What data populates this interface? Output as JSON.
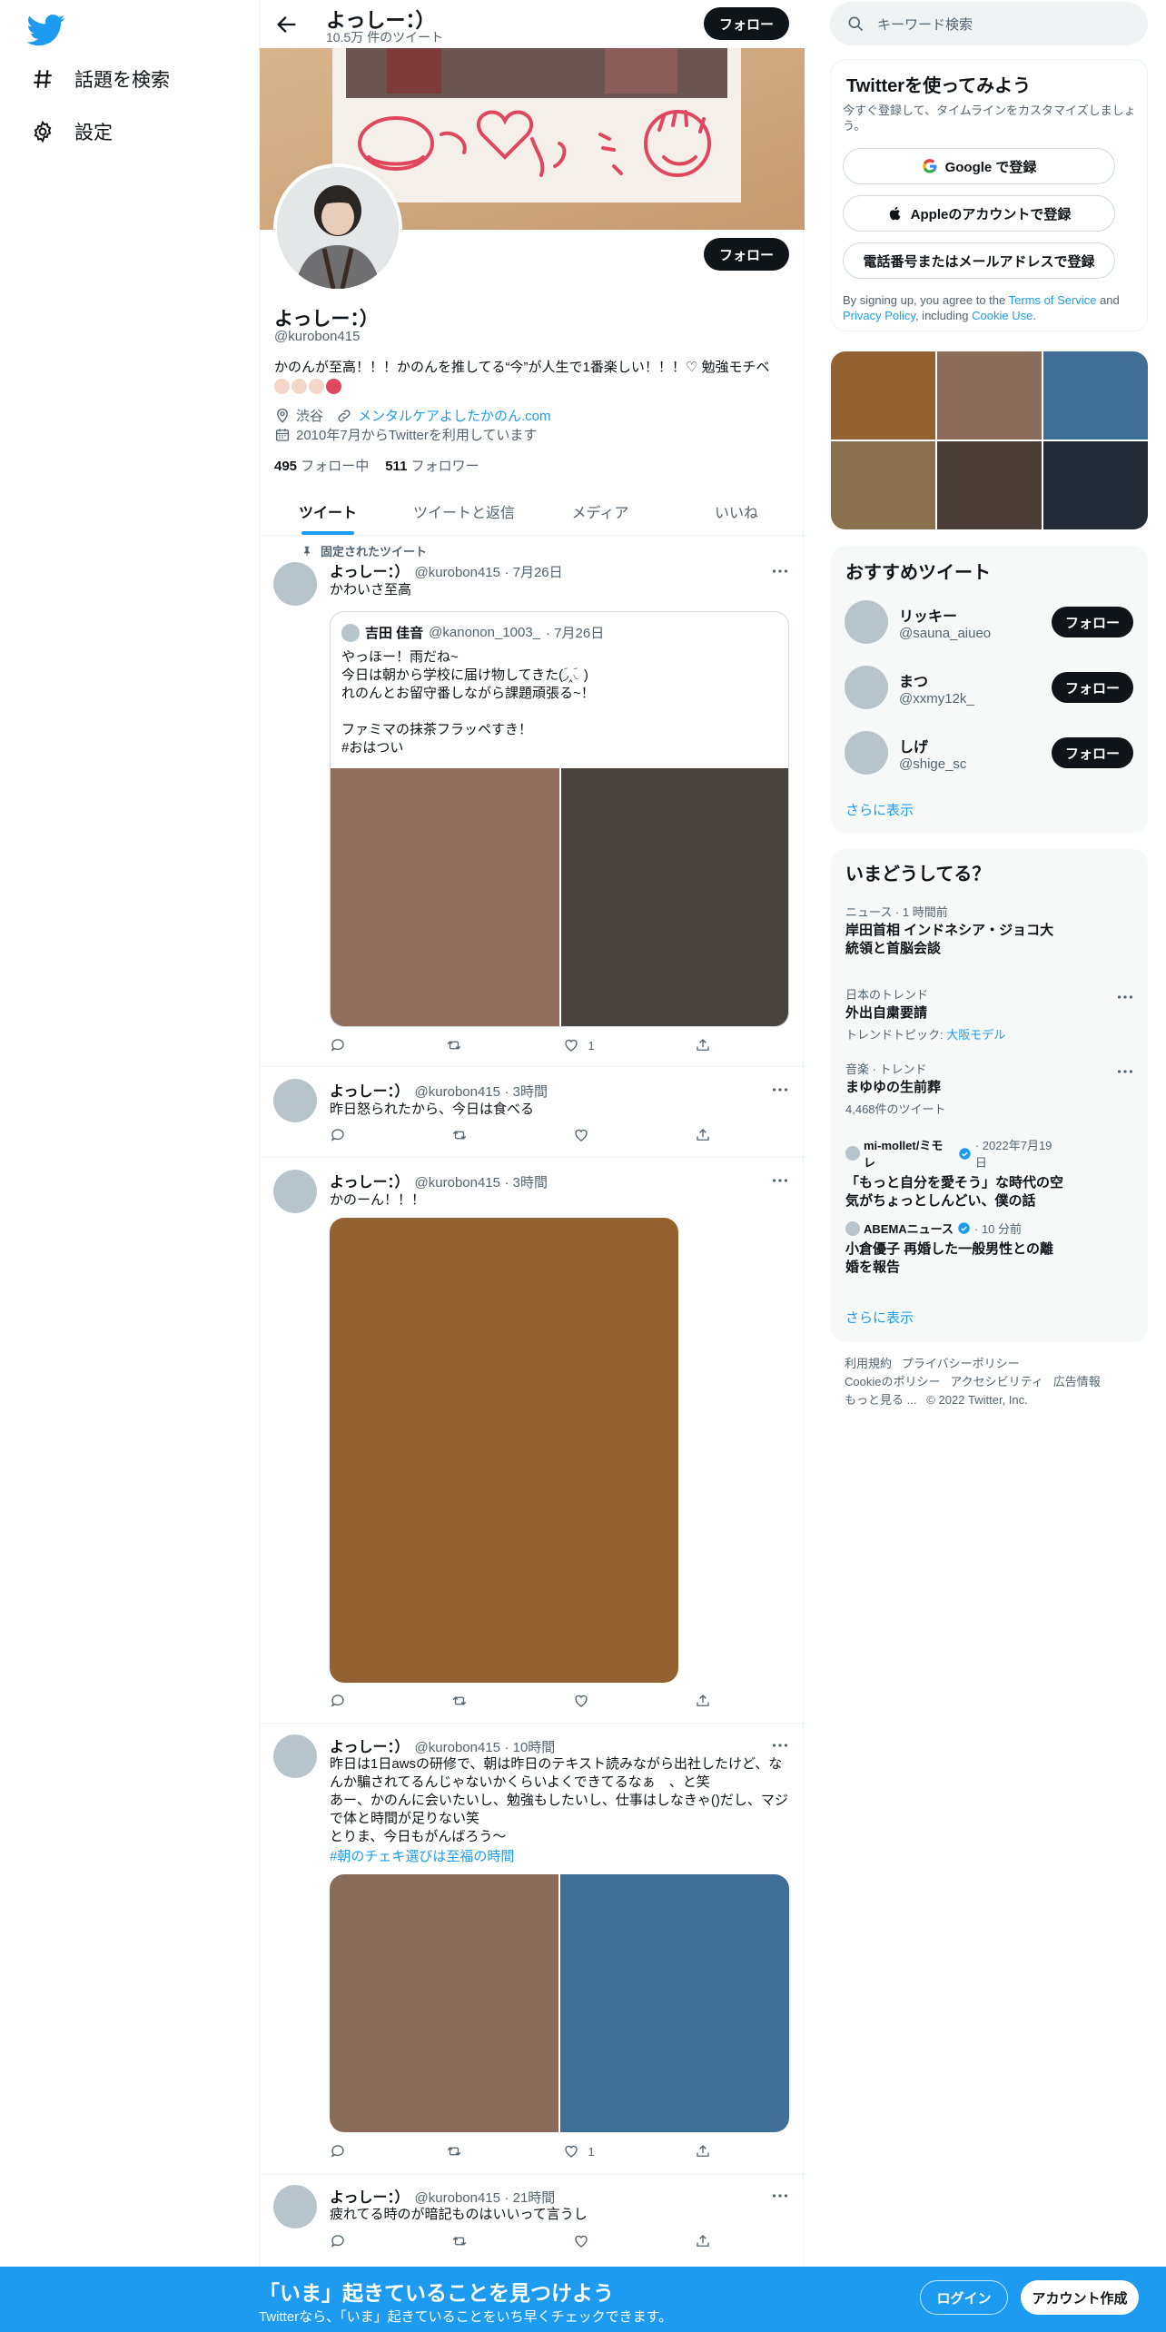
{
  "nav": {
    "explore_label": "話題を検索",
    "settings_label": "設定"
  },
  "header": {
    "name": "よっしー：）",
    "tweet_count": "10.5万 件のツイート"
  },
  "profile": {
    "follow_label": "フォロー",
    "display_name": "よっしー：）",
    "handle": "@kurobon415",
    "bio": "かのんが至高！！！かのんを推してる“今”が人生で1番楽しい！！！♡ 勉強モチベ",
    "location": "渋谷",
    "website": "メンタルケアよしたかのん.com",
    "joined": "2010年7月からTwitterを利用しています",
    "following_count": "495",
    "following_label": "フォロー中",
    "followers_count": "511",
    "followers_label": "フォロワー"
  },
  "tabs": [
    "ツイート",
    "ツイートと返信",
    "メディア",
    "いいね"
  ],
  "colors": {
    "accent": "#1d9bf0",
    "dark": "#0f1419",
    "muted": "#536471",
    "banner_ink": "#e0475e"
  },
  "tweets": [
    {
      "pinned_label": "固定されたツイート",
      "name": "よっしー：）",
      "handle": "@kurobon415",
      "time": "· 7月26日",
      "text": "かわいさ至高",
      "quote": {
        "name": "吉田 佳音",
        "handle": "@kanonon_1003_",
        "time": "· 7月26日",
        "text": "やっほー！雨だね~\n今日は朝から学校に届け物してきた(ؔ◞‸◟ؔ)\nれのんとお留守番しながら課題頑張る~！\n\nファミマの抹茶フラッペすき！\n#おはつい",
        "image_colors": [
          "#906d5c",
          "#4a423c"
        ]
      },
      "reply_count": "",
      "retweet_count": "",
      "like_count": "1"
    },
    {
      "name": "よっしー：）",
      "handle": "@kurobon415",
      "time": "· 3時間",
      "text": "昨日怒られたから、今日は食べる",
      "like_count": ""
    },
    {
      "name": "よっしー：）",
      "handle": "@kurobon415",
      "time": "· 3時間",
      "text": "かのーん！！！",
      "image_color": "#936230",
      "like_count": ""
    },
    {
      "name": "よっしー：）",
      "handle": "@kurobon415",
      "time": "· 10時間",
      "text": "昨日は1日awsの研修で、朝は昨日のテキスト読みながら出社したけど、なんか騙されてるんじゃないかくらいよくできてるなぁ　、と笑\nあー、かのんに会いたいし、勉強もしたいし、仕事はしなきゃ()だし、マジで体と時間が足りない笑\nとりま、今日もがんばろう〜",
      "hashtag": "#朝のチェキ選びは至福の時間",
      "image_colors": [
        "#8b6c5a",
        "#3f6f96"
      ],
      "like_count": "1"
    },
    {
      "name": "よっしー：）",
      "handle": "@kurobon415",
      "time": "· 21時間",
      "text": "疲れてる時のが暗記ものはいいって言うし",
      "like_count": ""
    }
  ],
  "sidebar": {
    "search_placeholder": "キーワード検索",
    "signup": {
      "title": "Twitterを使ってみよう",
      "subtitle": "今すぐ登録して、タイムラインをカスタマイズしましょう。",
      "google_label": "Google で登録",
      "apple_label": "Appleのアカウントで登録",
      "phone_label": "電話番号またはメールアドレスで登録",
      "legal_1": "By signing up, you agree to the",
      "terms": "Terms of Service",
      "legal_and": "and",
      "privacy": "Privacy Policy",
      "legal_including": ", including",
      "cookie": "Cookie Use",
      "period": "."
    },
    "media_colors": [
      "#936230",
      "#8b6c5a",
      "#3f6f96",
      "#8a704c",
      "#4b3e38",
      "#222a35"
    ],
    "recommended": {
      "title": "おすすめツイート",
      "follow_label": "フォロー",
      "users": [
        {
          "name": "リッキー",
          "handle": "@sauna_aiueo"
        },
        {
          "name": "まつ",
          "handle": "@xxmy12k_"
        },
        {
          "name": "しげ",
          "handle": "@shige_sc"
        }
      ],
      "show_more": "さらに表示"
    },
    "trends": {
      "title": "いまどうしてる？",
      "items": [
        {
          "meta": "ニュース · 1 時間前",
          "title": "岸田首相 インドネシア・ジョコ大統領と首脳会談"
        },
        {
          "meta": "日本のトレンド",
          "title": "外出自粛要請",
          "topic_prefix": "トレンドトピック: ",
          "topic": "大阪モデル"
        },
        {
          "meta": "音楽 · トレンド",
          "title": "まゆゆの生前葬",
          "count": "4,468件のツイート"
        },
        {
          "source": "mi-mollet/ミモレ",
          "time": "· 2022年7月19日",
          "title": "「もっと自分を愛そう」な時代の空気がちょっとしんどい、僕の話"
        },
        {
          "source": "ABEMAニュース",
          "time": "· 10 分前",
          "title": "小倉優子 再婚した一般男性との離婚を報告"
        }
      ],
      "show_more": "さらに表示"
    },
    "footer": {
      "terms": "利用規約",
      "privacy": "プライバシーポリシー",
      "cookie": "Cookieのポリシー",
      "accessibility": "アクセシビリティ",
      "ads": "広告情報",
      "more": "もっと見る ...",
      "copyright": "© 2022 Twitter, Inc."
    }
  },
  "bottom_bar": {
    "title": "「いま」起きていることを見つけよう",
    "subtitle": "Twitterなら、「いま」起きていることをいち早くチェックできます。",
    "login_label": "ログイン",
    "signup_label": "アカウント作成"
  }
}
